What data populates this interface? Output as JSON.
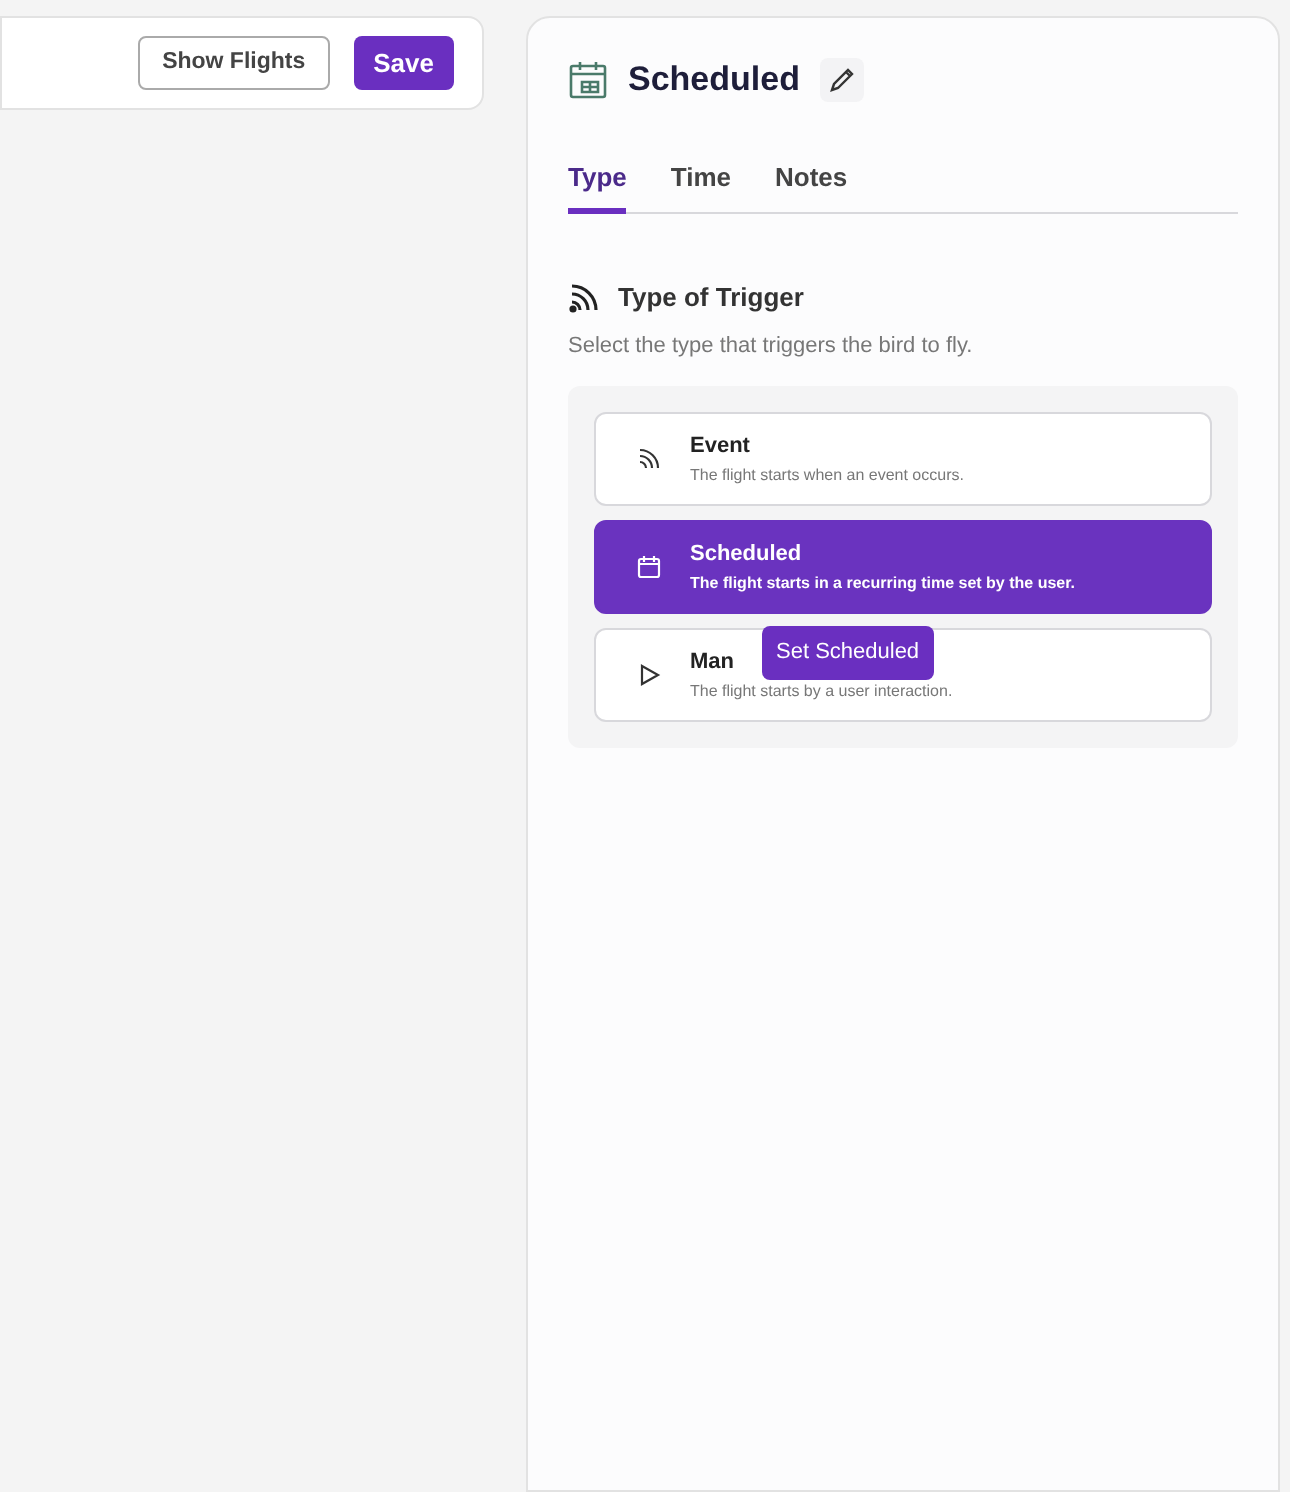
{
  "toolbar": {
    "buttons": [
      {
        "label": "Show Flights",
        "kind": "secondary"
      },
      {
        "label": "Save",
        "kind": "primary"
      }
    ]
  },
  "panel": {
    "title": "Scheduled",
    "tabs": [
      {
        "label": "Type",
        "selected": true
      },
      {
        "label": "Time",
        "selected": false
      },
      {
        "label": "Notes",
        "selected": false
      }
    ],
    "section_title": "Type of Trigger",
    "section_hint": "Select the type that triggers the bird to fly.",
    "options": [
      {
        "kind": "event",
        "label": "Event",
        "description": "The flight starts when an event occurs.",
        "selected": false
      },
      {
        "kind": "scheduled",
        "label": "Scheduled",
        "description": "The flight starts in a recurring time set by the user.",
        "selected": true
      },
      {
        "kind": "manual",
        "label": "Man",
        "description": "The flight starts by a user interaction.",
        "selected": false,
        "tooltip": "Set Scheduled"
      }
    ]
  }
}
